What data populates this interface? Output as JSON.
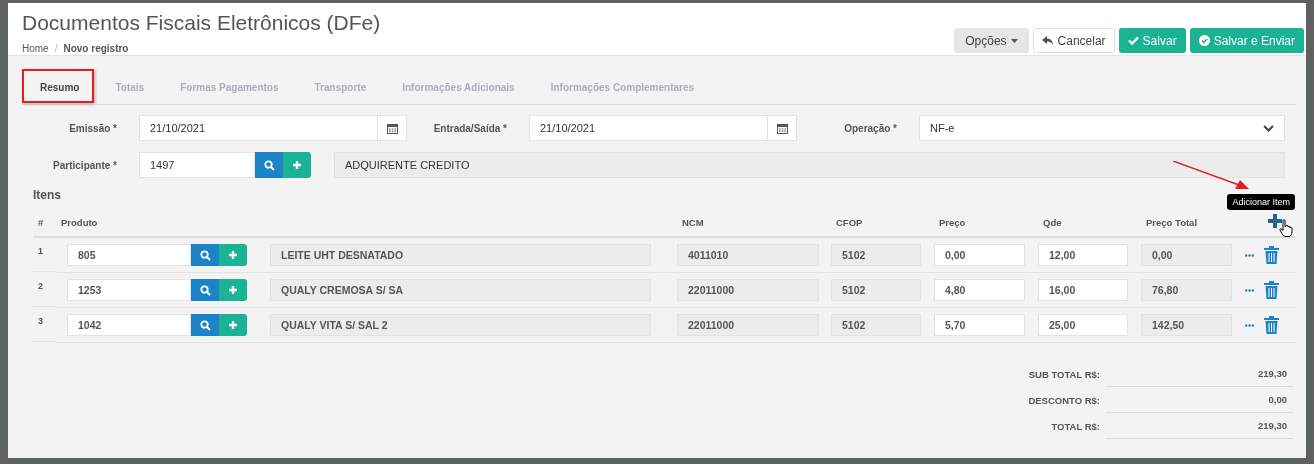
{
  "header": {
    "title": "Documentos Fiscais Eletrônicos (DFe)",
    "breadcrumb": [
      "Home",
      "Novo registro"
    ],
    "breadcrumb_separator": "/",
    "buttons": [
      {
        "label": "Opções",
        "kind": "dropdown"
      },
      {
        "label": "Cancelar",
        "kind": "cancel"
      },
      {
        "label": "Salvar",
        "kind": "save"
      },
      {
        "label": "Salvar e Enviar",
        "kind": "send"
      }
    ]
  },
  "tabs": [
    {
      "label": "Resumo",
      "selected": true
    },
    {
      "label": "Totais",
      "selected": false
    },
    {
      "label": "Formas Pagamentos",
      "selected": false
    },
    {
      "label": "Transporte",
      "selected": false
    },
    {
      "label": "Informações Adicionais",
      "selected": false
    },
    {
      "label": "Informações Complementares",
      "selected": false
    }
  ],
  "form": {
    "emissao": {
      "label": "Emissão *",
      "value": "21/10/2021"
    },
    "entrada_saida": {
      "label": "Entrada/Saída *",
      "value": "21/10/2021"
    },
    "operacao": {
      "label": "Operação *",
      "value": "NF-e"
    },
    "participante": {
      "label": "Participante *",
      "value": "1497",
      "name": "ADQUIRENTE CREDITO"
    }
  },
  "items": {
    "title": "Itens",
    "columns": [
      "#",
      "Produto",
      "NCM",
      "CFOP",
      "Preço",
      "Qde",
      "Preço Total"
    ],
    "add_tooltip": "Adicionar Item",
    "rows": [
      {
        "index": "1",
        "code": "805",
        "description": "LEITE UHT DESNATADO",
        "ncm": "4011010",
        "cfop": "5102",
        "price": "0,00",
        "qty": "12,00",
        "total": "0,00"
      },
      {
        "index": "2",
        "code": "1253",
        "description": "QUALY CREMOSA S/ SA",
        "ncm": "22011000",
        "cfop": "5102",
        "price": "4,80",
        "qty": "16,00",
        "total": "76,80"
      },
      {
        "index": "3",
        "code": "1042",
        "description": "QUALY VITA S/ SAL 2",
        "ncm": "22011000",
        "cfop": "5102",
        "price": "5,70",
        "qty": "25,00",
        "total": "142,50"
      }
    ]
  },
  "totals": [
    {
      "label": "SUB TOTAL R$:",
      "value": "219,30"
    },
    {
      "label": "DESCONTO R$:",
      "value": "0,00"
    },
    {
      "label": "TOTAL R$:",
      "value": "219,30"
    }
  ]
}
